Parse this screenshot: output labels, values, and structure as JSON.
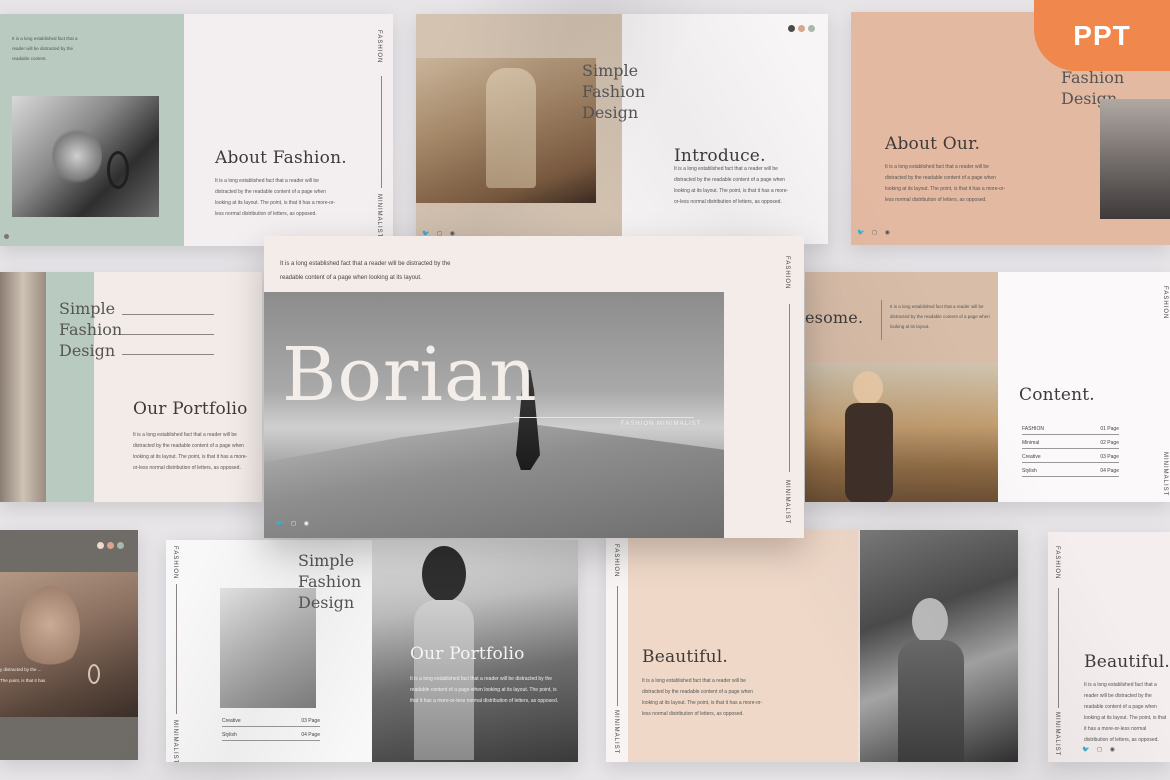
{
  "badge": {
    "label": "PPT",
    "color": "#f0884d"
  },
  "lorem": {
    "short": "It is a long established fact that a reader will be distracted by the readable content.",
    "para": "It is a long established fact that a reader will be distracted by the readable content of a page when looking at its layout. The point, is that it has a more-or-less normal distribution of letters, as opposed.",
    "main_top_1": "It is a long established fact that a reader will be distracted by the",
    "main_top_2": "readable content of a page when looking at its layout.",
    "para_partial": "y distracted by the ... The point, is that it has",
    "side": "It is a long established fact that a reader will be distracted by the readable content of a page when looking at its layout."
  },
  "labels": {
    "fashion": "FASHION",
    "minimalist": "MINIMALIST"
  },
  "social_icons": [
    "twitter-icon",
    "instagram-icon",
    "pinterest-icon"
  ],
  "social_glyphs": "🐦 ◻ ◉",
  "slides": {
    "s1": {
      "title": "About Fashion."
    },
    "s2": {
      "stack": [
        "Simple",
        "Fashion",
        "Design"
      ],
      "title": "Introduce."
    },
    "s3": {
      "stack": [
        "Fashion",
        "Design"
      ],
      "title": "About Our."
    },
    "s4": {
      "stack": [
        "Simple",
        "Fashion",
        "Design"
      ],
      "title": "Our Portfolio"
    },
    "main": {
      "title": "Borian",
      "subtitle": "FASHION MINIMALIST"
    },
    "s6": {
      "title_partial": "esome.",
      "title": "Content.",
      "toc": [
        {
          "name": "FASHION",
          "page": "01 Page"
        },
        {
          "name": "Minimal",
          "page": "02 Page"
        },
        {
          "name": "Creative",
          "page": "03 Page"
        },
        {
          "name": "Stylish",
          "page": "04 Page"
        }
      ]
    },
    "s8": {
      "stack": [
        "Simple",
        "Fashion",
        "Design"
      ],
      "title": "Our Portfolio",
      "toc": [
        {
          "name": "Creative",
          "page": "03 Page"
        },
        {
          "name": "Stylish",
          "page": "04 Page"
        }
      ]
    },
    "s9": {
      "title": "Beautiful."
    },
    "s10": {
      "title": "Beautiful."
    }
  },
  "colors": {
    "sage": "#b9cbc0",
    "blush": "#f3ece9",
    "peach": "#e4b9a2",
    "tan": "#d8bda8",
    "dot1": "#4a4a4a",
    "dot2": "#d9a58e",
    "dot3": "#a8b8ad"
  }
}
